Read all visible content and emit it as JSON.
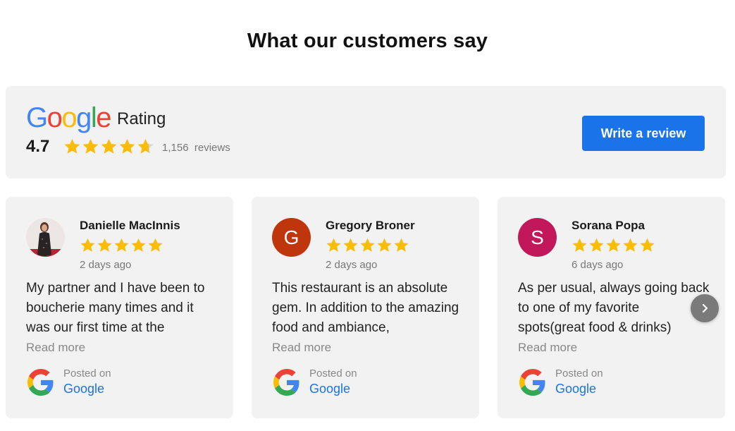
{
  "page": {
    "title": "What our customers say"
  },
  "summary": {
    "logo_letters": [
      {
        "char": "G",
        "color": "#4285F4"
      },
      {
        "char": "o",
        "color": "#EA4335"
      },
      {
        "char": "o",
        "color": "#FBBC05"
      },
      {
        "char": "g",
        "color": "#4285F4"
      },
      {
        "char": "l",
        "color": "#34A853"
      },
      {
        "char": "e",
        "color": "#EA4335"
      }
    ],
    "rating_label": "Rating",
    "average": "4.7",
    "stars_value": 4.7,
    "review_count": "1,156",
    "reviews_label": "reviews",
    "write_review_label": "Write a review"
  },
  "colors": {
    "star": "#FBBC05",
    "star_empty": "#d6d6d6",
    "accent": "#1a73e8"
  },
  "reviews": [
    {
      "name": "Danielle MacInnis",
      "avatar_type": "photo",
      "avatar_initial": "",
      "avatar_color": "#5a2e2e",
      "stars": 5,
      "date": "2 days ago",
      "text": "My partner and I have been to boucherie many times and it was our first time at the",
      "read_more": "Read more",
      "posted_on": "Posted on",
      "source": "Google"
    },
    {
      "name": "Gregory Broner",
      "avatar_type": "initial",
      "avatar_initial": "G",
      "avatar_color": "#bf360c",
      "stars": 5,
      "date": "2 days ago",
      "text": "This restaurant is an absolute gem. In addition to the amazing food and ambiance,",
      "read_more": "Read more",
      "posted_on": "Posted on",
      "source": "Google"
    },
    {
      "name": "Sorana Popa",
      "avatar_type": "initial",
      "avatar_initial": "S",
      "avatar_color": "#c2185b",
      "stars": 5,
      "date": "6 days ago",
      "text": "As per usual, always going back to one of my favorite spots(great food & drinks)",
      "read_more": "Read more",
      "posted_on": "Posted on",
      "source": "Google"
    }
  ],
  "carousel": {
    "next_icon": "chevron-right-icon"
  }
}
